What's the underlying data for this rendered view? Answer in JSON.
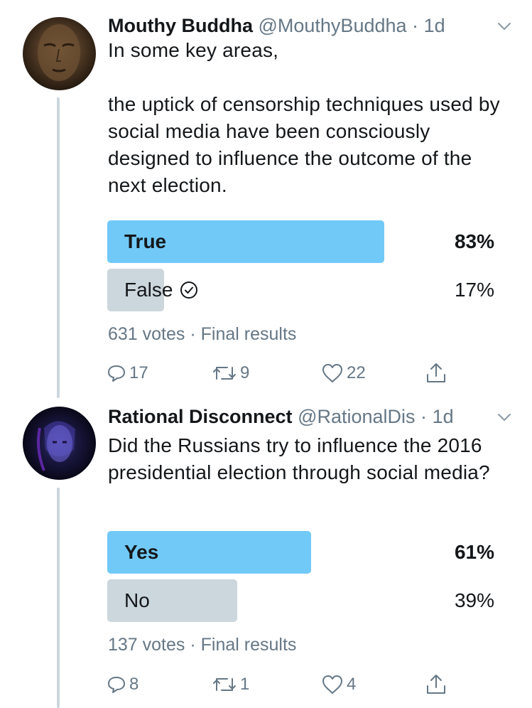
{
  "tweets": [
    {
      "name": "Mouthy Buddha",
      "handle": "@MouthyBuddha",
      "separator": "·",
      "time": "1d",
      "text": "In some key areas,\n\nthe uptick of censorship techniques used by social media have been consciously designed to influence the outcome of the next election.",
      "poll": {
        "options": [
          {
            "label": "True",
            "percent": "83%",
            "fraction": 0.83,
            "winner": true,
            "voted": false
          },
          {
            "label": "False",
            "percent": "17%",
            "fraction": 0.17,
            "winner": false,
            "voted": true
          }
        ],
        "votes": "631 votes",
        "status": "Final results"
      },
      "actions": {
        "replies": "17",
        "retweets": "9",
        "likes": "22"
      }
    },
    {
      "name": "Rational Disconnect",
      "handle": "@RationalDis",
      "separator": "·",
      "time": "1d",
      "text": "Did the Russians try to influence the 2016 presidential election through social media?",
      "poll": {
        "options": [
          {
            "label": "Yes",
            "percent": "61%",
            "fraction": 0.61,
            "winner": true,
            "voted": false
          },
          {
            "label": "No",
            "percent": "39%",
            "fraction": 0.39,
            "winner": false,
            "voted": false
          }
        ],
        "votes": "137 votes",
        "status": "Final results"
      },
      "actions": {
        "replies": "8",
        "retweets": "1",
        "likes": "4"
      }
    }
  ],
  "colors": {
    "winner_bar": "#71c9f8",
    "other_bar": "#ccd6dd",
    "secondary_text": "#657786",
    "primary_text": "#14171a"
  },
  "icons": [
    "chevron-down-icon",
    "check-circle-icon",
    "reply-icon",
    "retweet-icon",
    "like-icon",
    "share-icon"
  ]
}
